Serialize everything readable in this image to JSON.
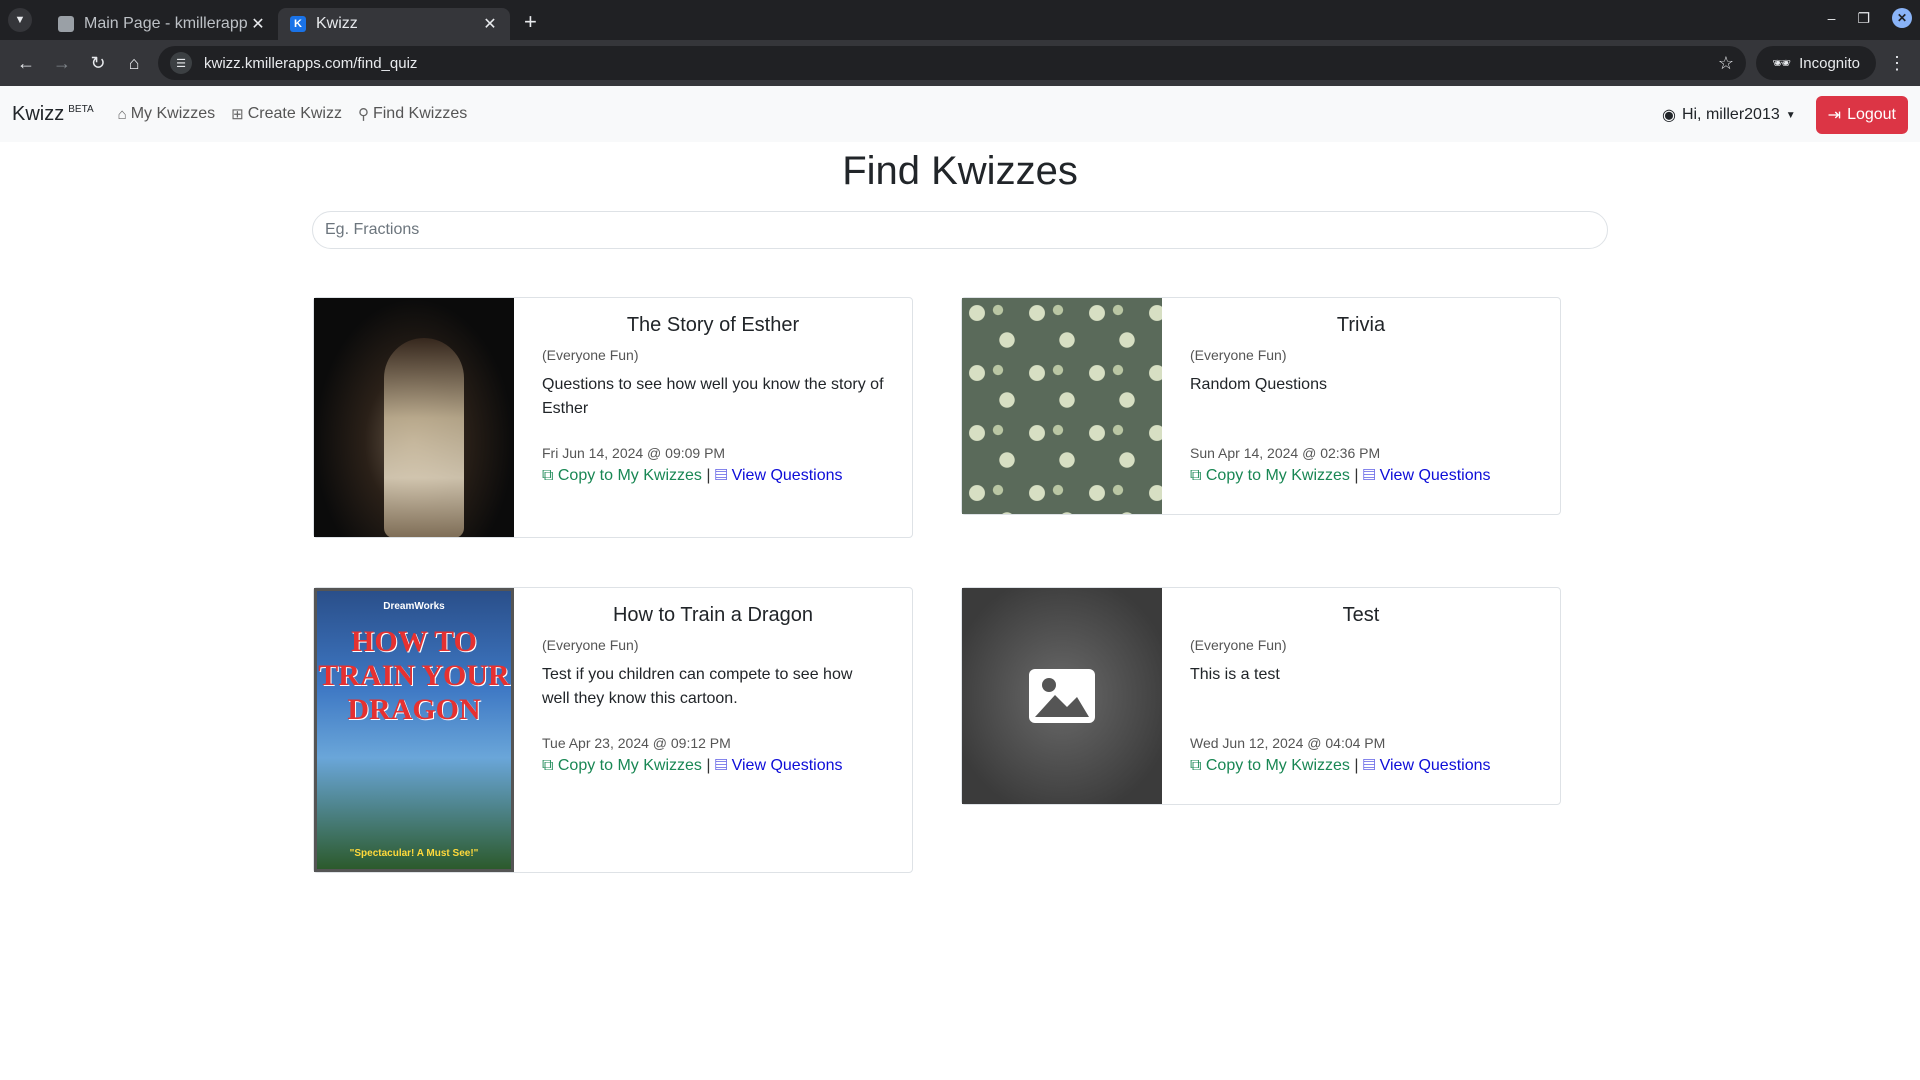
{
  "browser": {
    "tabs": [
      {
        "title": "Main Page - kmillerapps",
        "active": false
      },
      {
        "title": "Kwizz",
        "active": true
      }
    ],
    "url": "kwizz.kmillerapps.com/find_quiz",
    "incognito_label": "Incognito"
  },
  "nav": {
    "brand": "Kwizz",
    "beta": "BETA",
    "links": [
      "My Kwizzes",
      "Create Kwizz",
      "Find Kwizzes"
    ],
    "user": "Hi, miller2013",
    "logout": "Logout"
  },
  "page": {
    "title": "Find Kwizzes",
    "search_placeholder": "Eg. Fractions"
  },
  "links": {
    "copy": "Copy to My Kwizzes",
    "separator": "|",
    "view": "View Questions"
  },
  "quizzes": [
    {
      "title": "The Story of Esther",
      "category": "(Everyone Fun)",
      "description": "Questions to see how well you know the story of Esther",
      "date": "Fri Jun 14, 2024 @ 09:09 PM"
    },
    {
      "title": "Trivia",
      "category": "(Everyone Fun)",
      "description": "Random Questions",
      "date": "Sun Apr 14, 2024 @ 02:36 PM"
    },
    {
      "title": "How to Train a Dragon",
      "category": "(Everyone Fun)",
      "description": "Test if you children can compete to see how well they know this cartoon.",
      "date": "Tue Apr 23, 2024 @ 09:12 PM"
    },
    {
      "title": "Test",
      "category": "(Everyone Fun)",
      "description": "This is a test",
      "date": "Wed Jun 12, 2024 @ 04:04 PM"
    }
  ],
  "poster": {
    "studio": "DreamWorks",
    "headline": "HOW TO TRAIN YOUR DRAGON",
    "tagline": "\"Spectacular! A Must See!\""
  },
  "colors": {
    "logout": "#dc3545",
    "copy_link": "#198754",
    "view_link": "#0d0dd8"
  }
}
